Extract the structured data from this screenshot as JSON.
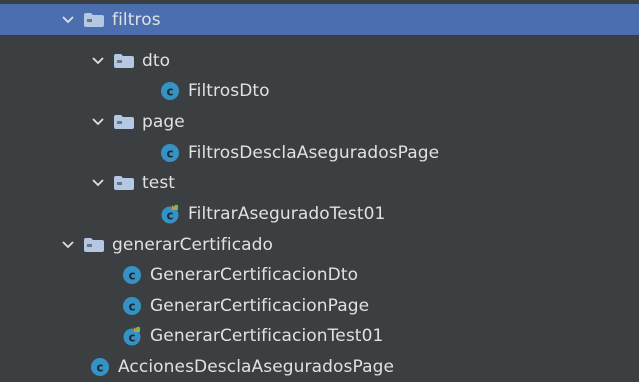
{
  "tree": {
    "nodes": [
      {
        "label": "filtros",
        "kind": "folder",
        "expanded": true,
        "selected": true
      },
      {
        "label": "dto",
        "kind": "folder",
        "expanded": true
      },
      {
        "label": "FiltrosDto",
        "kind": "class"
      },
      {
        "label": "page",
        "kind": "folder",
        "expanded": true
      },
      {
        "label": "FiltrosDesclaAseguradosPage",
        "kind": "class"
      },
      {
        "label": "test",
        "kind": "folder",
        "expanded": true
      },
      {
        "label": "FiltrarAseguradoTest01",
        "kind": "test-class"
      },
      {
        "label": "generarCertificado",
        "kind": "folder",
        "expanded": true
      },
      {
        "label": "GenerarCertificacionDto",
        "kind": "class"
      },
      {
        "label": "GenerarCertificacionPage",
        "kind": "class"
      },
      {
        "label": "GenerarCertificacionTest01",
        "kind": "test-class"
      },
      {
        "label": "AccionesDesclaAseguradosPage",
        "kind": "class"
      }
    ]
  },
  "colors": {
    "background": "#3c3f41",
    "selected_row": "#4b6eaf",
    "text": "#dfe1e5",
    "folder_icon": "#b4c8e4",
    "class_icon": "#3592c4",
    "test_marker": "#e58a3a"
  }
}
